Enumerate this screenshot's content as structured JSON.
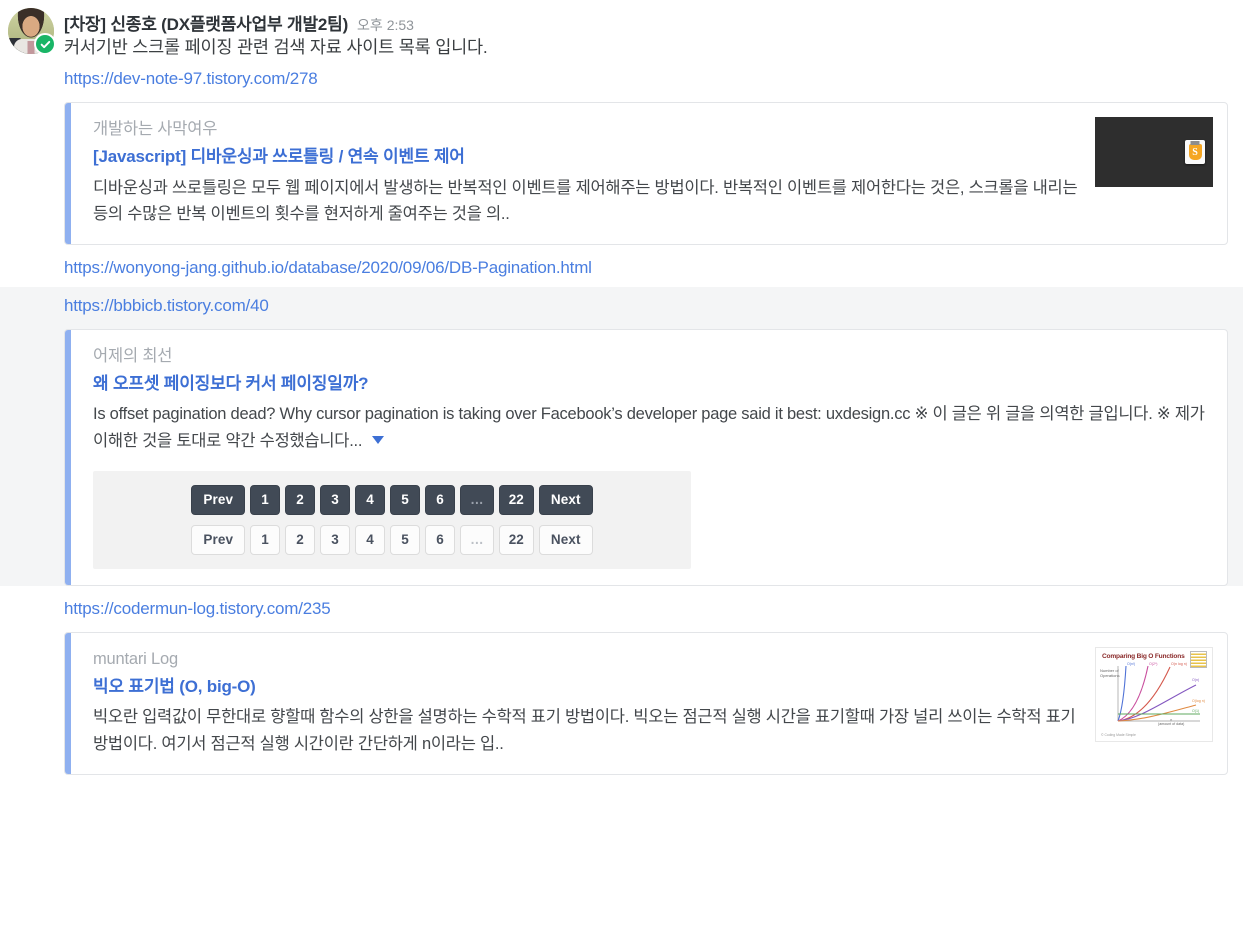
{
  "message": {
    "sender": "[차장] 신종호 (DX플랫폼사업부 개발2팀)",
    "time": "오후 2:53",
    "text": "커서기반 스크롤 페이징 관련 검색 자료 사이트 목록 입니다.",
    "avatar_alt": "user-avatar",
    "verified": true
  },
  "links": [
    {
      "url": "https://dev-note-97.tistory.com/278",
      "highlighted": false
    },
    {
      "url": "https://wonyong-jang.github.io/database/2020/09/06/DB-Pagination.html",
      "highlighted": false
    },
    {
      "url": "https://bbbicb.tistory.com/40",
      "highlighted": true
    },
    {
      "url": "https://codermun-log.tistory.com/235",
      "highlighted": false
    }
  ],
  "cards": [
    {
      "site": "개발하는 사막여우",
      "title": "[Javascript] 디바운싱과 쓰로틀링 / 연속 이벤트 제어",
      "description": "디바운싱과 쓰로틀링은 모두 웹 페이지에서 발생하는 반복적인 이벤트를 제어해주는 방법이다. 반복적인 이벤트를 제어한다는 것은, 스크롤을 내리는 등의 수많은 반복 이벤트의 횟수를 현저하게 줄여주는 것을 의..",
      "thumbnail": "javascript-logo-thumbnail",
      "has_expand": false
    },
    {
      "site": "어제의 최선",
      "title": "왜 오프셋 페이징보다 커서 페이징일까?",
      "description": "Is offset pagination dead? Why cursor pagination is taking over Facebook’s developer page said it best: uxdesign.cc ※ 이 글은 위 글을 의역한 글입니다. ※ 제가 이해한 것을 토대로 약간 수정했습니다...",
      "thumbnail": "pagination-buttons-screenshot",
      "has_expand": true
    },
    {
      "site": "muntari Log",
      "title": "빅오 표기법 (O, big-O)",
      "description": "빅오란 입력값이 무한대로 향할때 함수의 상한을 설명하는 수학적 표기 방법이다. 빅오는 점근적 실행 시간을 표기할때 가장 널리 쓰이는 수학적 표기 방법이다. 여기서 점근적 실행 시간이란 간단하게 n이라는 입..",
      "thumbnail": "big-o-chart-thumbnail",
      "has_expand": false
    }
  ],
  "pagination_preview": {
    "labels": [
      "Prev",
      "1",
      "2",
      "3",
      "4",
      "5",
      "6",
      "…",
      "22",
      "Next"
    ],
    "dark_row_style": "dark",
    "light_row_style": "light"
  },
  "bigo_thumb": {
    "title": "Comparing Big O Functions",
    "ylabel": "Number of\nOperations",
    "xlabel": "n\n(amount of data)",
    "footer": "© 2015 Rowan Curtis, Coding Made Simple",
    "series": [
      "O(n!)",
      "O(2ⁿ)",
      "O(n²)",
      "O(n log n)",
      "O(n)",
      "O(log n)",
      "O(1)"
    ]
  },
  "colors": {
    "link": "#4a7ee0",
    "title": "#3d6fd4",
    "accent_bar": "#8fb0f0",
    "highlight": "#f4f5f6",
    "verified": "#19b566"
  }
}
